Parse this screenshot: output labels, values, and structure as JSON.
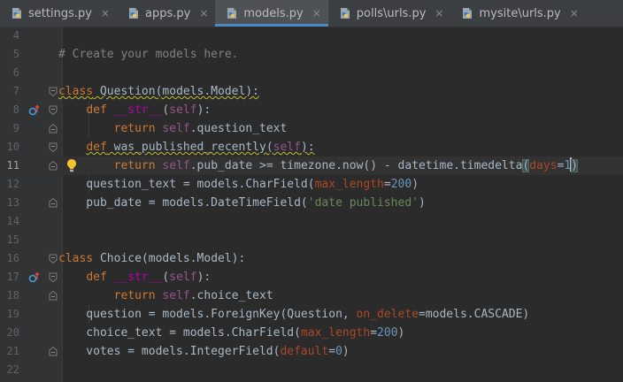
{
  "tabs": [
    {
      "label": "settings.py",
      "active": false
    },
    {
      "label": "apps.py",
      "active": false
    },
    {
      "label": "models.py",
      "active": true
    },
    {
      "label": "polls\\urls.py",
      "active": false
    },
    {
      "label": "mysite\\urls.py",
      "active": false
    }
  ],
  "tab_close_glyph": "×",
  "editor": {
    "current_line": 11,
    "lines": [
      {
        "n": "4",
        "tokens": []
      },
      {
        "n": "5",
        "tokens": [
          {
            "t": "# Create your models here.",
            "c": "c-cmt"
          }
        ]
      },
      {
        "n": "6",
        "tokens": []
      },
      {
        "n": "7",
        "tokens": [
          {
            "t": "class",
            "c": "c-kw squiggle"
          },
          {
            "t": " Question",
            "c": "c-def squiggle"
          },
          {
            "t": "(models.Model):",
            "c": "c-def squiggle"
          }
        ]
      },
      {
        "n": "8",
        "tokens": [
          {
            "t": "    "
          },
          {
            "t": "def",
            "c": "c-kw"
          },
          {
            "t": " "
          },
          {
            "t": "__str__",
            "c": "c-dunder"
          },
          {
            "t": "("
          },
          {
            "t": "self",
            "c": "c-self"
          },
          {
            "t": "):"
          }
        ]
      },
      {
        "n": "9",
        "tokens": [
          {
            "t": "        "
          },
          {
            "t": "return",
            "c": "c-kw"
          },
          {
            "t": " "
          },
          {
            "t": "self",
            "c": "c-self"
          },
          {
            "t": ".question_text"
          }
        ]
      },
      {
        "n": "10",
        "tokens": [
          {
            "t": "    "
          },
          {
            "t": "def",
            "c": "c-kw squiggle"
          },
          {
            "t": " was_published_recently",
            "c": "c-def squiggle"
          },
          {
            "t": "(",
            "c": "squiggle"
          },
          {
            "t": "self",
            "c": "c-self squiggle"
          },
          {
            "t": "):",
            "c": "squiggle"
          }
        ]
      },
      {
        "n": "11",
        "tokens": [
          {
            "t": "        "
          },
          {
            "t": "return",
            "c": "c-kw"
          },
          {
            "t": " "
          },
          {
            "t": "self",
            "c": "c-self"
          },
          {
            "t": ".pub_date >= timezone.now() - datetime.timedelta"
          },
          {
            "t": "(",
            "c": "bracket-match"
          },
          {
            "t": "days",
            "c": "c-param"
          },
          {
            "t": "="
          },
          {
            "t": "1",
            "c": "c-num"
          },
          {
            "t": ")",
            "c": "bracket-match",
            "caret": true
          }
        ]
      },
      {
        "n": "12",
        "tokens": [
          {
            "t": "    question_text = models.CharField("
          },
          {
            "t": "max_length",
            "c": "c-param"
          },
          {
            "t": "="
          },
          {
            "t": "200",
            "c": "c-num"
          },
          {
            "t": ")"
          }
        ]
      },
      {
        "n": "13",
        "tokens": [
          {
            "t": "    pub_date = models.DateTimeField("
          },
          {
            "t": "'date published'",
            "c": "c-str"
          },
          {
            "t": ")"
          }
        ]
      },
      {
        "n": "14",
        "tokens": []
      },
      {
        "n": "15",
        "tokens": []
      },
      {
        "n": "16",
        "tokens": [
          {
            "t": "class",
            "c": "c-kw"
          },
          {
            "t": " Choice(models.Model):"
          }
        ]
      },
      {
        "n": "17",
        "tokens": [
          {
            "t": "    "
          },
          {
            "t": "def",
            "c": "c-kw"
          },
          {
            "t": " "
          },
          {
            "t": "__str__",
            "c": "c-dunder"
          },
          {
            "t": "("
          },
          {
            "t": "self",
            "c": "c-self"
          },
          {
            "t": "):"
          }
        ]
      },
      {
        "n": "18",
        "tokens": [
          {
            "t": "        "
          },
          {
            "t": "return",
            "c": "c-kw"
          },
          {
            "t": " "
          },
          {
            "t": "self",
            "c": "c-self"
          },
          {
            "t": ".choice_text"
          }
        ]
      },
      {
        "n": "19",
        "tokens": [
          {
            "t": "    question = models.ForeignKey(Question, "
          },
          {
            "t": "on_delete",
            "c": "c-param"
          },
          {
            "t": "=models.CASCADE)"
          }
        ]
      },
      {
        "n": "20",
        "tokens": [
          {
            "t": "    choice_text = models.CharField("
          },
          {
            "t": "max_length",
            "c": "c-param"
          },
          {
            "t": "="
          },
          {
            "t": "200",
            "c": "c-num"
          },
          {
            "t": ")"
          }
        ]
      },
      {
        "n": "21",
        "tokens": [
          {
            "t": "    votes = models.IntegerField("
          },
          {
            "t": "default",
            "c": "c-param"
          },
          {
            "t": "="
          },
          {
            "t": "0",
            "c": "c-num"
          },
          {
            "t": ")"
          }
        ]
      },
      {
        "n": "22",
        "tokens": []
      }
    ]
  },
  "gutter_marks": {
    "8": "override-icon",
    "17": "override-icon"
  },
  "fold_marks": {
    "7": "fold-start",
    "8": "fold-start",
    "9": "fold-end",
    "10": "fold-start",
    "11": "fold-end",
    "13": "fold-end",
    "16": "fold-start",
    "17": "fold-start",
    "18": "fold-end",
    "21": "fold-end"
  },
  "intention_bulb_line": "11",
  "colors": {
    "editor_bg": "#2b2b2b",
    "gutter_bg": "#313335",
    "tab_active_underline": "#4a88c7",
    "keyword": "#cc7832",
    "self": "#94558d",
    "string": "#6a8759",
    "number": "#6897bb",
    "param": "#aa4926",
    "comment": "#808080",
    "dunder": "#b200b2"
  }
}
